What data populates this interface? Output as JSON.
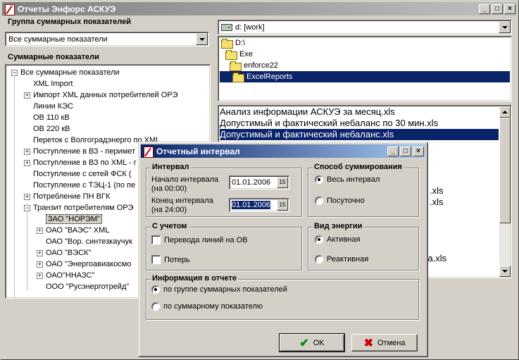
{
  "main_window": {
    "title": "Отчеты Энфорс АСКУЭ"
  },
  "left": {
    "group_label": "Группа суммарных показателей",
    "group_combo_value": "Все суммарные показатели",
    "indicators_label": "Суммарные показатели",
    "tree": [
      {
        "label": "Все суммарные показатели",
        "expander": "−"
      },
      {
        "label": "XML Import",
        "expander": ""
      },
      {
        "label": "Импорт XML данных потребителей ОРЭ",
        "expander": "+"
      },
      {
        "label": "Линии КЭС",
        "expander": ""
      },
      {
        "label": "ОВ 110 кВ",
        "expander": ""
      },
      {
        "label": "ОВ 220 кВ",
        "expander": ""
      },
      {
        "label": "Переток с Волгоградэнерго по XML",
        "expander": ""
      },
      {
        "label": "Поступление в ВЗ - перимет",
        "expander": "+"
      },
      {
        "label": "Поступление в ВЗ по XML - г",
        "expander": "+"
      },
      {
        "label": "Поступление с сетей ФСК (",
        "expander": ""
      },
      {
        "label": "Поступление с ТЭЦ-1 (по пе",
        "expander": ""
      },
      {
        "label": "Потребление ПН ВГК",
        "expander": "+"
      },
      {
        "label": "Транзит потребителям ОРЭ",
        "expander": "−"
      },
      {
        "label": "ЗАО \"НОРЭМ\"",
        "expander": ""
      },
      {
        "label": "ОАО \"ВАЭС\" XML",
        "expander": "+"
      },
      {
        "label": "ОАО \"Вор. синтезкаучук",
        "expander": ""
      },
      {
        "label": "ОАО \"ВЭСК\"",
        "expander": "+"
      },
      {
        "label": "ОАО \"Энергоавиакосмо",
        "expander": "+"
      },
      {
        "label": "ОАО\"ННАЗС\"",
        "expander": "+"
      },
      {
        "label": "ООО \"Русэнерготрейд\"",
        "expander": ""
      }
    ]
  },
  "right": {
    "drive_value": "d: [work]",
    "folders": [
      "D:\\",
      "Exe",
      "enforce22",
      "ExcelReports"
    ],
    "files": [
      "Анализ информации АСКУЭ за месяц.xls",
      "Допустимый и фактический небаланс по 30 мин.xls",
      "Допустимый и фактический небаланс.xls",
      "",
      "",
      "",
      "",
      ".xls",
      ".xls",
      "",
      "",
      "",
      "",
      "ца.xls"
    ]
  },
  "dialog": {
    "title": "Отчетный интервал",
    "interval": {
      "title": "Интервал",
      "start_label_1": "Начало интервала",
      "start_label_2": "(на 00:00)",
      "start_value": "01.01.2006",
      "end_label_1": "Конец интервала",
      "end_label_2": "(на 24:00)",
      "end_value": "01.01.2006",
      "cal_glyph": "15"
    },
    "summation": {
      "title": "Способ суммирования",
      "opt_whole": "Весь интервал",
      "opt_hourly": "Посуточно"
    },
    "accounting": {
      "title": "С учетом",
      "opt_lines": "Перевода линий на ОВ",
      "opt_losses": "Потерь"
    },
    "energy": {
      "title": "Вид энергии",
      "opt_active": "Активная",
      "opt_reactive": "Реактивная"
    },
    "report_info": {
      "title": "Информация в отчете",
      "opt_group": "по группе суммарных показателей",
      "opt_single": "по суммарному показателю"
    },
    "ok_label": "OK",
    "cancel_label": "Отмена"
  }
}
